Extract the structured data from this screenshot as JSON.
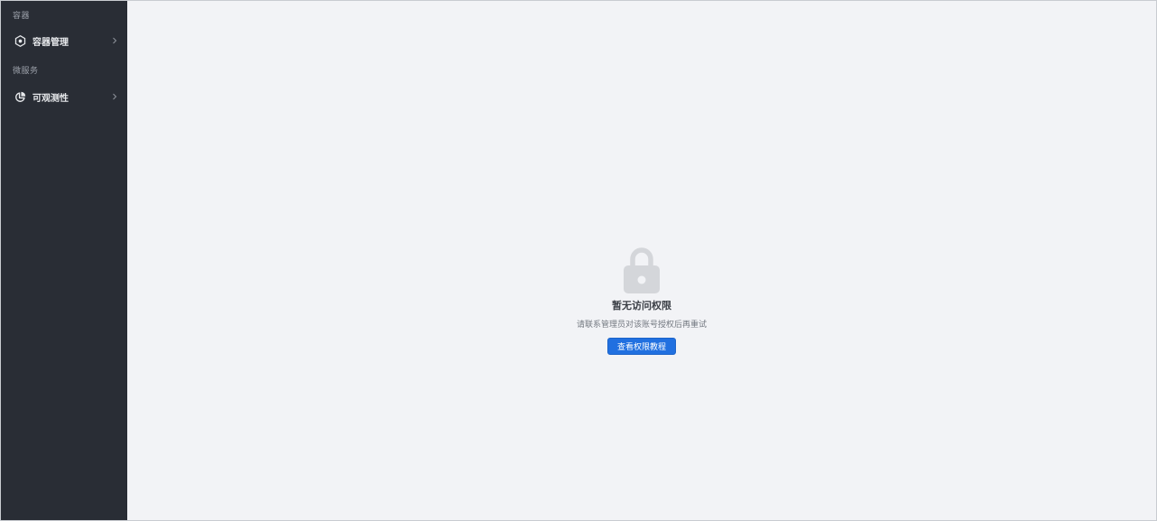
{
  "sidebar": {
    "groups": [
      {
        "label": "容器",
        "items": [
          {
            "label": "容器管理",
            "icon": "hexagon-gear-icon"
          }
        ]
      },
      {
        "label": "微服务",
        "items": [
          {
            "label": "可观测性",
            "icon": "pie-chart-icon"
          }
        ]
      }
    ],
    "chevron_icon": "chevron-right-icon"
  },
  "main": {
    "empty_state": {
      "icon": "lock-icon",
      "title": "暂无访问权限",
      "description": "请联系管理员对该账号授权后再重试",
      "button_label": "查看权限教程"
    }
  },
  "colors": {
    "sidebar_bg": "#292d35",
    "main_bg": "#f2f3f6",
    "primary": "#2170e0",
    "lock_gray": "#d4d6da"
  }
}
